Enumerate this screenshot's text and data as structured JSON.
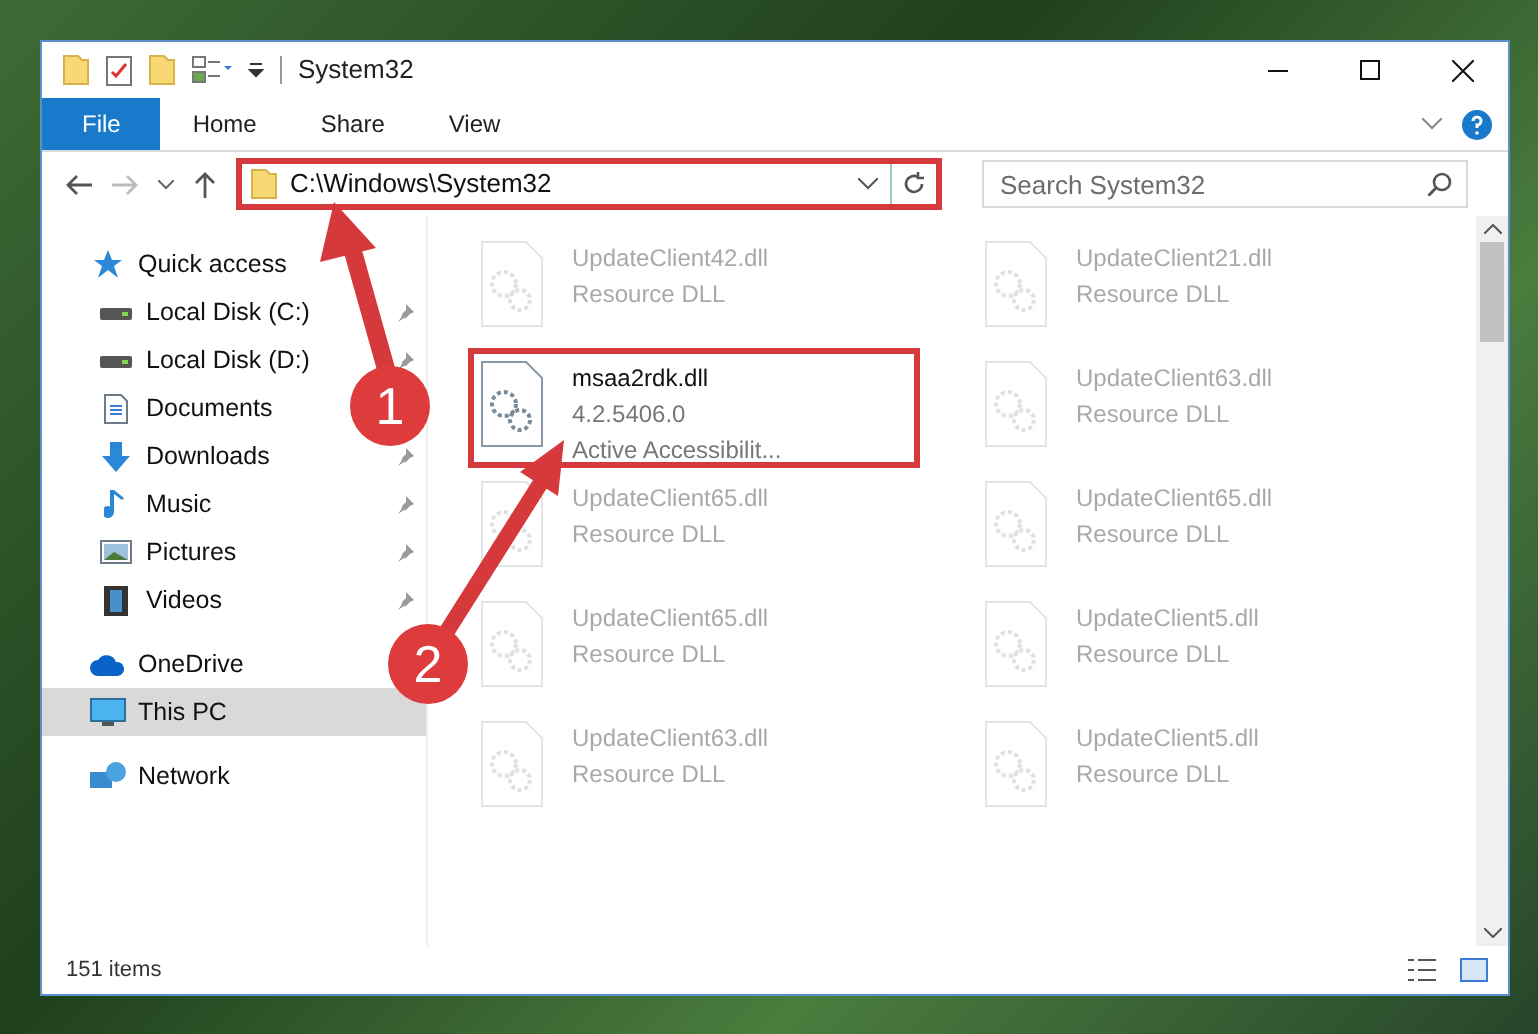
{
  "window": {
    "title": "System32"
  },
  "ribbon_tabs": [
    {
      "label": "File",
      "kind": "file"
    },
    {
      "label": "Home",
      "kind": "tab"
    },
    {
      "label": "Share",
      "kind": "tab"
    },
    {
      "label": "View",
      "kind": "tab"
    }
  ],
  "address_bar": {
    "path": "C:\\Windows\\System32",
    "outlined": true
  },
  "search": {
    "placeholder": "Search System32"
  },
  "sidebar": {
    "items": [
      {
        "label": "Quick access",
        "kind": "star",
        "indent": false,
        "selected": false
      },
      {
        "label": "Local Disk (C:)",
        "kind": "drive",
        "indent": true,
        "pinned": true,
        "selected": false
      },
      {
        "label": "Local Disk (D:)",
        "kind": "drive",
        "indent": true,
        "pinned": true,
        "selected": false
      },
      {
        "label": "Documents",
        "kind": "doc",
        "indent": true,
        "pinned": false,
        "selected": false
      },
      {
        "label": "Downloads",
        "kind": "download",
        "indent": true,
        "pinned": true,
        "selected": false
      },
      {
        "label": "Music",
        "kind": "music",
        "indent": true,
        "pinned": true,
        "selected": false
      },
      {
        "label": "Pictures",
        "kind": "picture",
        "indent": true,
        "pinned": true,
        "selected": false
      },
      {
        "label": "Videos",
        "kind": "video",
        "indent": true,
        "pinned": true,
        "selected": false
      },
      {
        "label": "OneDrive",
        "kind": "cloud",
        "indent": false,
        "selected": false
      },
      {
        "label": "This PC",
        "kind": "pc",
        "indent": false,
        "pinned": false,
        "selected": true
      },
      {
        "label": "Network",
        "kind": "network",
        "indent": false,
        "selected": false
      }
    ]
  },
  "files": [
    {
      "name": "UpdateClient42.dll",
      "details": [
        "Resource DLL"
      ],
      "dimmed": true,
      "outlined": false
    },
    {
      "name": "UpdateClient21.dll",
      "details": [
        "Resource DLL"
      ],
      "dimmed": true,
      "outlined": false
    },
    {
      "name": "msaa2rdk.dll",
      "details": [
        "4.2.5406.0",
        "Active Accessibilit..."
      ],
      "dimmed": false,
      "outlined": true
    },
    {
      "name": "UpdateClient63.dll",
      "details": [
        "Resource DLL"
      ],
      "dimmed": true,
      "outlined": false
    },
    {
      "name": "UpdateClient65.dll",
      "details": [
        "Resource DLL"
      ],
      "dimmed": true,
      "outlined": false
    },
    {
      "name": "UpdateClient65.dll",
      "details": [
        "Resource DLL"
      ],
      "dimmed": true,
      "outlined": false
    },
    {
      "name": "UpdateClient65.dll",
      "details": [
        "Resource DLL"
      ],
      "dimmed": true,
      "outlined": false
    },
    {
      "name": "UpdateClient5.dll",
      "details": [
        "Resource DLL"
      ],
      "dimmed": true,
      "outlined": false
    },
    {
      "name": "UpdateClient63.dll",
      "details": [
        "Resource DLL"
      ],
      "dimmed": true,
      "outlined": false
    },
    {
      "name": "UpdateClient5.dll",
      "details": [
        "Resource DLL"
      ],
      "dimmed": true,
      "outlined": false
    }
  ],
  "status_bar": {
    "count": "151 items"
  },
  "annotations": [
    {
      "number": "1"
    },
    {
      "number": "2"
    }
  ]
}
